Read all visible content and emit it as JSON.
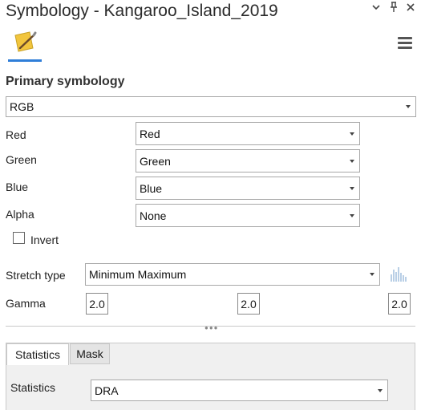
{
  "window": {
    "title": "Symbology - Kangaroo_Island_2019"
  },
  "icons": {
    "menu": "chevron-down-icon",
    "pin": "pin-icon",
    "close": "close-icon",
    "symbology": "paintbrush-icon",
    "hamburger": "hamburger-menu-icon",
    "histogram": "histogram-icon"
  },
  "primary": {
    "heading": "Primary symbology",
    "renderer": "RGB",
    "bands": [
      {
        "label": "Red",
        "value": "Red"
      },
      {
        "label": "Green",
        "value": "Green"
      },
      {
        "label": "Blue",
        "value": "Blue"
      },
      {
        "label": "Alpha",
        "value": "None"
      }
    ],
    "invert_label": "Invert",
    "stretch_label": "Stretch type",
    "stretch_value": "Minimum Maximum",
    "gamma_label": "Gamma",
    "gamma_values": [
      "2.0",
      "2.0",
      "2.0"
    ]
  },
  "tabs": [
    {
      "label": "Statistics",
      "active": true
    },
    {
      "label": "Mask",
      "active": false
    }
  ],
  "statistics": {
    "label": "Statistics",
    "value": "DRA"
  },
  "colors": {
    "accent": "#2f7ed8",
    "icon_yellow": "#f2c53d"
  }
}
